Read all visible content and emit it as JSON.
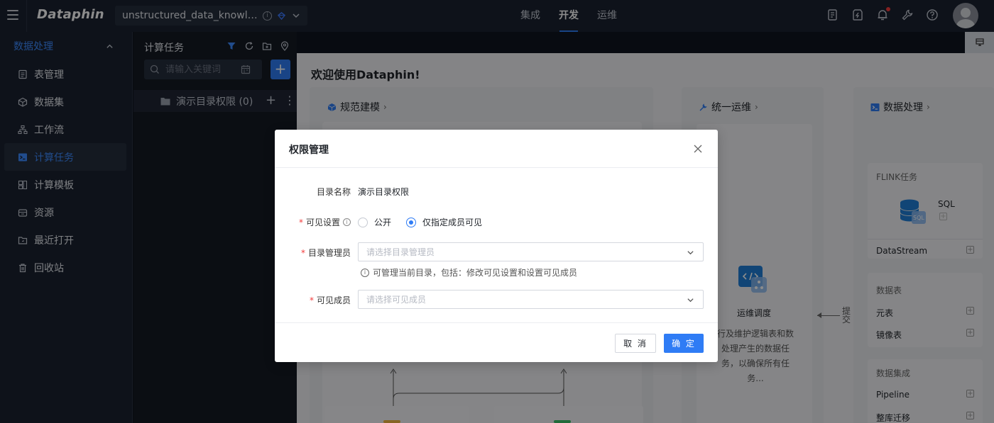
{
  "header": {
    "logo": "Dataphin",
    "project": "unstructured_data_knowledg...",
    "nav": [
      {
        "label": "集成",
        "active": false
      },
      {
        "label": "开发",
        "active": true
      },
      {
        "label": "运维",
        "active": false
      }
    ],
    "icons": [
      "task-list-icon",
      "plugin-icon",
      "bell-icon",
      "wrench-icon",
      "help-icon"
    ]
  },
  "sidebar": {
    "section": "数据处理",
    "items": [
      {
        "label": "表管理",
        "icon": "table-icon",
        "active": false
      },
      {
        "label": "数据集",
        "icon": "cube-icon",
        "active": false
      },
      {
        "label": "工作流",
        "icon": "workflow-icon",
        "active": false
      },
      {
        "label": "计算任务",
        "icon": "terminal-icon",
        "active": true
      },
      {
        "label": "计算模板",
        "icon": "template-icon",
        "active": false
      },
      {
        "label": "资源",
        "icon": "resource-icon",
        "active": false
      },
      {
        "label": "最近打开",
        "icon": "recent-icon",
        "active": false
      },
      {
        "label": "回收站",
        "icon": "trash-icon",
        "active": false
      }
    ]
  },
  "task_panel": {
    "title": "计算任务",
    "search_placeholder": "请输入关键词",
    "tree": [
      {
        "label": "演示目录权限 (0)"
      }
    ]
  },
  "main": {
    "welcome": "欢迎使用Dataphin!",
    "cards": [
      {
        "title": "规范建模"
      },
      {
        "title": "统一运维"
      },
      {
        "title": "数据处理"
      }
    ],
    "ops": {
      "title": "运维调度",
      "desc": "行及维护逻辑表和数处理产生的数据任务，以确保所有任务..."
    },
    "submit_label": "提交",
    "right_panel": {
      "flink_title": "FLINK任务",
      "sql_label": "SQL",
      "datastream_label": "DataStream",
      "datatable_title": "数据表",
      "meta_table": "元表",
      "mirror_table": "镜像表",
      "integration_title": "数据集成",
      "pipeline": "Pipeline",
      "migration": "整库迁移"
    }
  },
  "modal": {
    "title": "权限管理",
    "dir_name_label": "目录名称",
    "dir_name_value": "演示目录权限",
    "visibility_label": "可见设置",
    "visibility_options": [
      {
        "label": "公开",
        "checked": false
      },
      {
        "label": "仅指定成员可见",
        "checked": true
      }
    ],
    "admin_label": "目录管理员",
    "admin_placeholder": "请选择目录管理员",
    "admin_help": "可管理当前目录，包括：修改可见设置和设置可见成员",
    "members_label": "可见成员",
    "members_placeholder": "请选择可见成员",
    "cancel_label": "取 消",
    "ok_label": "确 定"
  }
}
